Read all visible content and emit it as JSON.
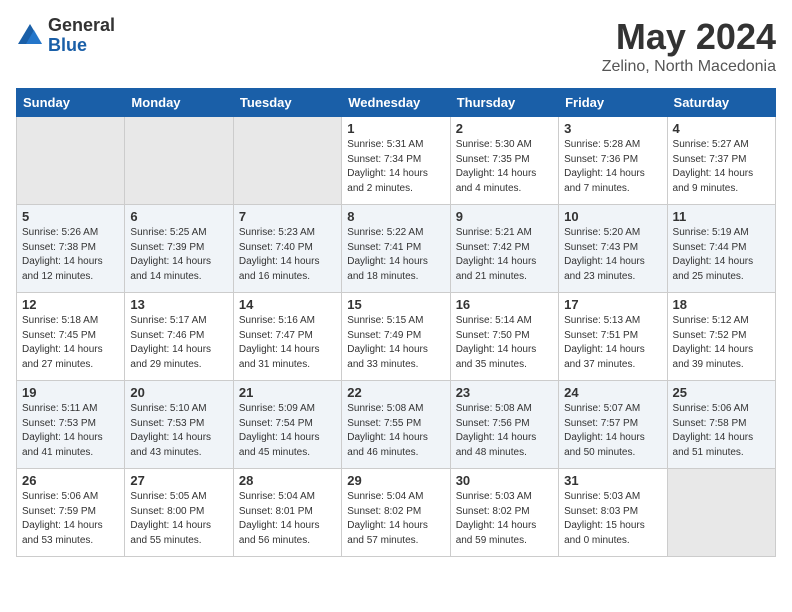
{
  "logo": {
    "general": "General",
    "blue": "Blue"
  },
  "title": "May 2024",
  "location": "Zelino, North Macedonia",
  "days_of_week": [
    "Sunday",
    "Monday",
    "Tuesday",
    "Wednesday",
    "Thursday",
    "Friday",
    "Saturday"
  ],
  "weeks": [
    [
      {
        "day": "",
        "content": ""
      },
      {
        "day": "",
        "content": ""
      },
      {
        "day": "",
        "content": ""
      },
      {
        "day": "1",
        "content": "Sunrise: 5:31 AM\nSunset: 7:34 PM\nDaylight: 14 hours\nand 2 minutes."
      },
      {
        "day": "2",
        "content": "Sunrise: 5:30 AM\nSunset: 7:35 PM\nDaylight: 14 hours\nand 4 minutes."
      },
      {
        "day": "3",
        "content": "Sunrise: 5:28 AM\nSunset: 7:36 PM\nDaylight: 14 hours\nand 7 minutes."
      },
      {
        "day": "4",
        "content": "Sunrise: 5:27 AM\nSunset: 7:37 PM\nDaylight: 14 hours\nand 9 minutes."
      }
    ],
    [
      {
        "day": "5",
        "content": "Sunrise: 5:26 AM\nSunset: 7:38 PM\nDaylight: 14 hours\nand 12 minutes."
      },
      {
        "day": "6",
        "content": "Sunrise: 5:25 AM\nSunset: 7:39 PM\nDaylight: 14 hours\nand 14 minutes."
      },
      {
        "day": "7",
        "content": "Sunrise: 5:23 AM\nSunset: 7:40 PM\nDaylight: 14 hours\nand 16 minutes."
      },
      {
        "day": "8",
        "content": "Sunrise: 5:22 AM\nSunset: 7:41 PM\nDaylight: 14 hours\nand 18 minutes."
      },
      {
        "day": "9",
        "content": "Sunrise: 5:21 AM\nSunset: 7:42 PM\nDaylight: 14 hours\nand 21 minutes."
      },
      {
        "day": "10",
        "content": "Sunrise: 5:20 AM\nSunset: 7:43 PM\nDaylight: 14 hours\nand 23 minutes."
      },
      {
        "day": "11",
        "content": "Sunrise: 5:19 AM\nSunset: 7:44 PM\nDaylight: 14 hours\nand 25 minutes."
      }
    ],
    [
      {
        "day": "12",
        "content": "Sunrise: 5:18 AM\nSunset: 7:45 PM\nDaylight: 14 hours\nand 27 minutes."
      },
      {
        "day": "13",
        "content": "Sunrise: 5:17 AM\nSunset: 7:46 PM\nDaylight: 14 hours\nand 29 minutes."
      },
      {
        "day": "14",
        "content": "Sunrise: 5:16 AM\nSunset: 7:47 PM\nDaylight: 14 hours\nand 31 minutes."
      },
      {
        "day": "15",
        "content": "Sunrise: 5:15 AM\nSunset: 7:49 PM\nDaylight: 14 hours\nand 33 minutes."
      },
      {
        "day": "16",
        "content": "Sunrise: 5:14 AM\nSunset: 7:50 PM\nDaylight: 14 hours\nand 35 minutes."
      },
      {
        "day": "17",
        "content": "Sunrise: 5:13 AM\nSunset: 7:51 PM\nDaylight: 14 hours\nand 37 minutes."
      },
      {
        "day": "18",
        "content": "Sunrise: 5:12 AM\nSunset: 7:52 PM\nDaylight: 14 hours\nand 39 minutes."
      }
    ],
    [
      {
        "day": "19",
        "content": "Sunrise: 5:11 AM\nSunset: 7:53 PM\nDaylight: 14 hours\nand 41 minutes."
      },
      {
        "day": "20",
        "content": "Sunrise: 5:10 AM\nSunset: 7:53 PM\nDaylight: 14 hours\nand 43 minutes."
      },
      {
        "day": "21",
        "content": "Sunrise: 5:09 AM\nSunset: 7:54 PM\nDaylight: 14 hours\nand 45 minutes."
      },
      {
        "day": "22",
        "content": "Sunrise: 5:08 AM\nSunset: 7:55 PM\nDaylight: 14 hours\nand 46 minutes."
      },
      {
        "day": "23",
        "content": "Sunrise: 5:08 AM\nSunset: 7:56 PM\nDaylight: 14 hours\nand 48 minutes."
      },
      {
        "day": "24",
        "content": "Sunrise: 5:07 AM\nSunset: 7:57 PM\nDaylight: 14 hours\nand 50 minutes."
      },
      {
        "day": "25",
        "content": "Sunrise: 5:06 AM\nSunset: 7:58 PM\nDaylight: 14 hours\nand 51 minutes."
      }
    ],
    [
      {
        "day": "26",
        "content": "Sunrise: 5:06 AM\nSunset: 7:59 PM\nDaylight: 14 hours\nand 53 minutes."
      },
      {
        "day": "27",
        "content": "Sunrise: 5:05 AM\nSunset: 8:00 PM\nDaylight: 14 hours\nand 55 minutes."
      },
      {
        "day": "28",
        "content": "Sunrise: 5:04 AM\nSunset: 8:01 PM\nDaylight: 14 hours\nand 56 minutes."
      },
      {
        "day": "29",
        "content": "Sunrise: 5:04 AM\nSunset: 8:02 PM\nDaylight: 14 hours\nand 57 minutes."
      },
      {
        "day": "30",
        "content": "Sunrise: 5:03 AM\nSunset: 8:02 PM\nDaylight: 14 hours\nand 59 minutes."
      },
      {
        "day": "31",
        "content": "Sunrise: 5:03 AM\nSunset: 8:03 PM\nDaylight: 15 hours\nand 0 minutes."
      },
      {
        "day": "",
        "content": ""
      }
    ]
  ]
}
